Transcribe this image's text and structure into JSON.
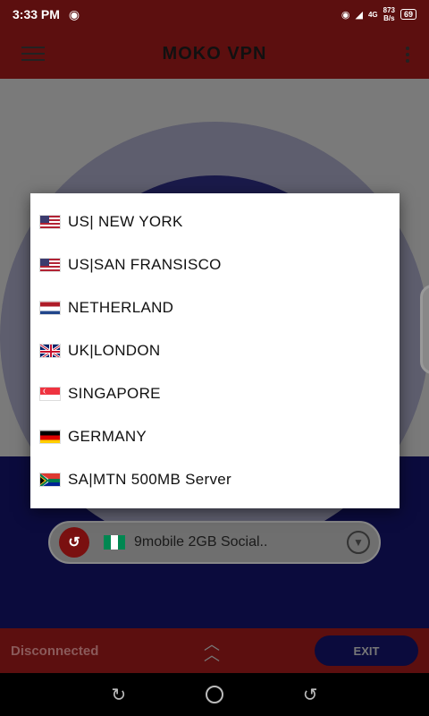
{
  "statusbar": {
    "time": "3:33 PM",
    "net_speed_value": "873",
    "net_speed_unit": "B/s",
    "battery": "69",
    "signal_label": "4G"
  },
  "appbar": {
    "title": "MOKO VPN"
  },
  "dialog": {
    "items": [
      {
        "label": "US| NEW YORK",
        "flag": "us-flag-icon"
      },
      {
        "label": "US|SAN FRANSISCO",
        "flag": "us-flag-icon"
      },
      {
        "label": "NETHERLAND",
        "flag": "netherlands-flag-icon"
      },
      {
        "label": "UK|LONDON",
        "flag": "uk-flag-icon"
      },
      {
        "label": "SINGAPORE",
        "flag": "singapore-flag-icon"
      },
      {
        "label": "GERMANY",
        "flag": "germany-flag-icon"
      },
      {
        "label": "SA|MTN 500MB Server",
        "flag": "south-africa-flag-icon"
      }
    ]
  },
  "server_select": {
    "label": "9mobile 2GB Social..",
    "flag": "nigeria-flag-icon"
  },
  "footer": {
    "status": "Disconnected",
    "exit_label": "EXIT"
  },
  "colors": {
    "primary": "#5c0f0f",
    "navy": "#0b0b3d"
  }
}
